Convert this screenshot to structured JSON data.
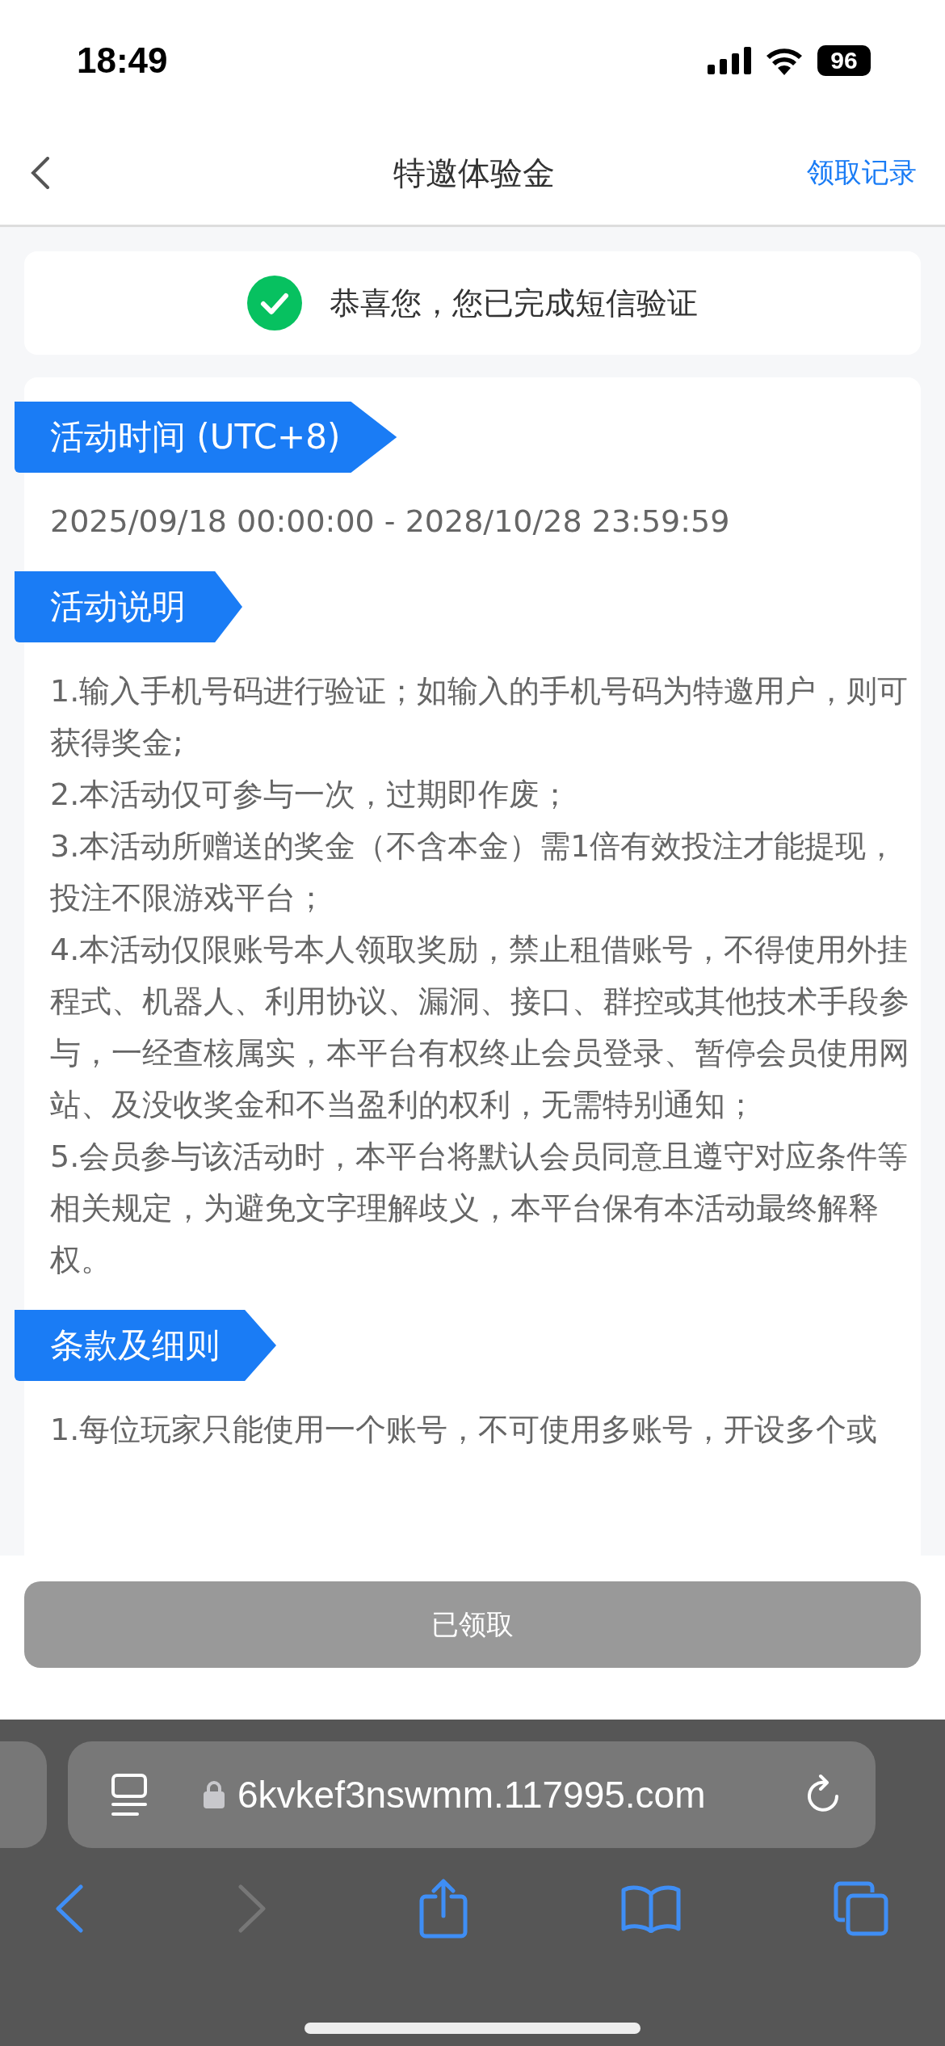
{
  "status_bar": {
    "time": "18:49",
    "battery": "96"
  },
  "nav": {
    "title": "特邀体验金",
    "action": "领取记录"
  },
  "notice": {
    "text": "恭喜您，您已完成短信验证",
    "verified": true
  },
  "sections": [
    {
      "heading": "活动时间 (UTC+8)",
      "paragraphs": [
        "2025/09/18 00:00:00 - 2028/10/28 23:59:59"
      ]
    },
    {
      "heading": "活动说明",
      "paragraphs": [
        "1.输入手机号码进行验证；如输入的手机号码为特邀用户，则可获得奖金;",
        "2.本活动仅可参与一次，过期即作废；",
        "3.本活动所赠送的奖金（不含本金）需1倍有效投注才能提现，投注不限游戏平台；",
        "4.本活动仅限账号本人领取奖励，禁止租借账号，不得使用外挂程式、机器人、利用协议、漏洞、接口、群控或其他技术手段参与，一经查核属实，本平台有权终止会员登录、暂停会员使用网站、及没收奖金和不当盈利的权利，无需特别通知；",
        "5.会员参与该活动时，本平台将默认会员同意且遵守对应条件等相关规定，为避免文字理解歧义，本平台保有本活动最终解释权。"
      ]
    },
    {
      "heading": "条款及细则",
      "paragraphs": [
        "1.每位玩家只能使用一个账号，不可使用多账号，开设多个或"
      ]
    }
  ],
  "claim_button": {
    "label": "已领取",
    "disabled": true
  },
  "browser": {
    "url": "6kvkef3nswmm.117995.com",
    "forward_enabled": false
  }
}
